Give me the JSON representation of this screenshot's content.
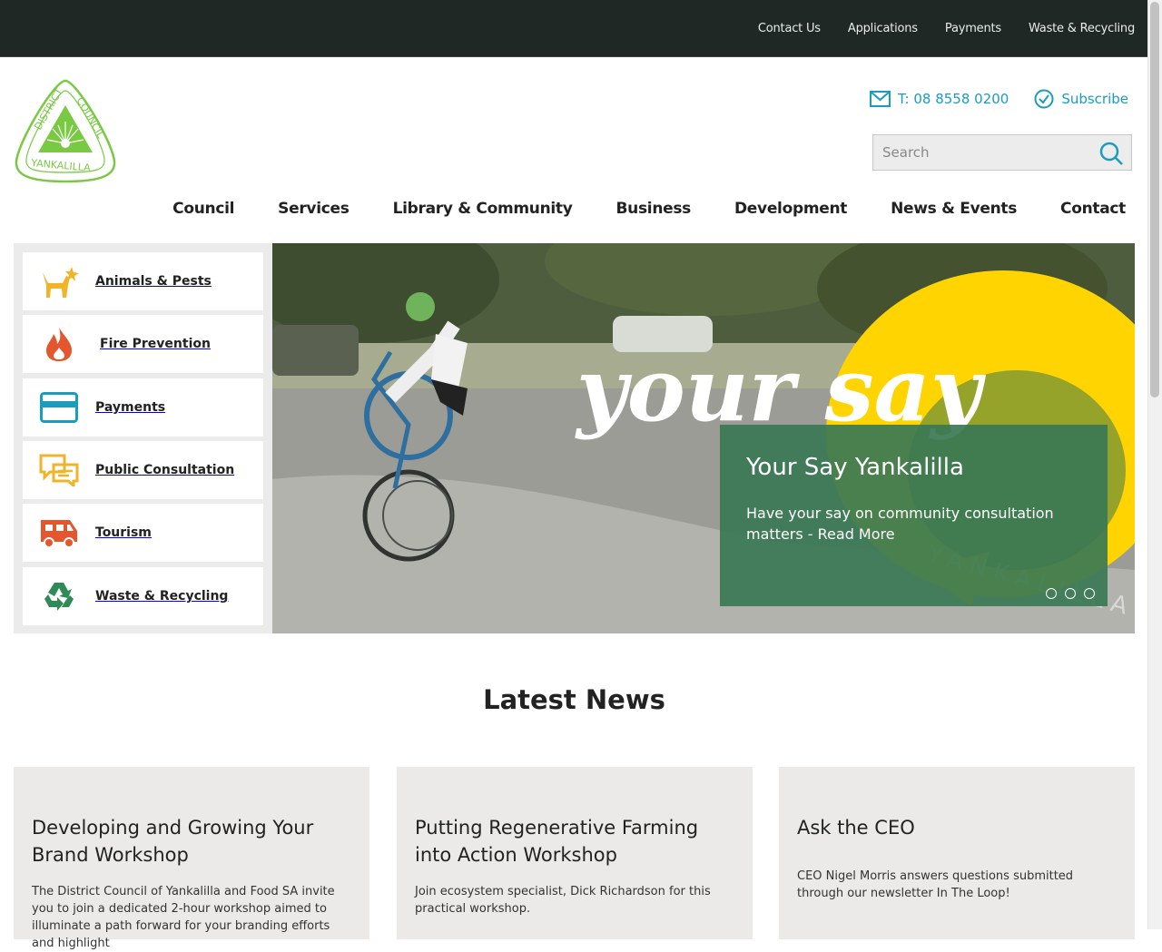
{
  "topnav": {
    "items": [
      "Contact Us",
      "Applications",
      "Payments",
      "Waste & Recycling"
    ]
  },
  "logo": {
    "alt": "District Council Yankalilla"
  },
  "header": {
    "phone": "T: 08 8558 0200",
    "subscribe": "Subscribe",
    "search_placeholder": "Search"
  },
  "mainnav": {
    "items": [
      "Council",
      "Services",
      "Library & Community",
      "Business",
      "Development",
      "News & Events",
      "Contact"
    ]
  },
  "quicklinks": [
    {
      "label": "Animals & Pests",
      "icon": "dog-icon",
      "color": "#f0b429"
    },
    {
      "label": "Fire Prevention",
      "icon": "flame-icon",
      "color": "#e4572e"
    },
    {
      "label": "Payments",
      "icon": "credit-card-icon",
      "color": "#1a9cbf"
    },
    {
      "label": "Public Consultation",
      "icon": "speech-bubbles-icon",
      "color": "#f0b429"
    },
    {
      "label": "Tourism",
      "icon": "caravan-icon",
      "color": "#e4572e"
    },
    {
      "label": "Waste & Recycling",
      "icon": "recycle-icon",
      "color": "#2e8b57"
    }
  ],
  "hero": {
    "title": "Your Say Yankalilla",
    "description": "Have your say on community consultation matters - Read More",
    "slide_count": 3
  },
  "news": {
    "heading": "Latest News",
    "items": [
      {
        "title": "Developing and Growing Your Brand Workshop",
        "summary": "The District Council of Yankalilla and Food SA invite you to join a dedicated 2-hour workshop aimed to illuminate a path forward for your branding efforts and highlight"
      },
      {
        "title": "Putting Regenerative Farming into Action Workshop",
        "summary": "Join ecosystem specialist, Dick Richardson for this practical workshop."
      },
      {
        "title": "Ask the CEO",
        "summary": "CEO Nigel Morris answers questions submitted through our newsletter In The Loop!"
      }
    ]
  },
  "colors": {
    "topbar": "#202825",
    "accent": "#1a9cbf",
    "caption_bg": "#397854",
    "logo_green": "#7ac943"
  }
}
